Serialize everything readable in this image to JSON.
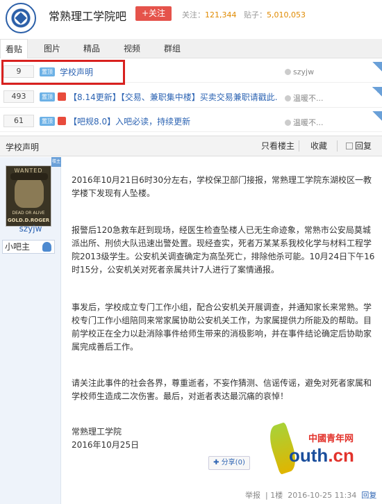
{
  "header": {
    "forum_name": "常熟理工学院吧",
    "follow_label": "+关注",
    "follow_count_label": "关注：",
    "follow_count": "121,344",
    "posts_label": "贴子：",
    "posts_count": "5,010,053"
  },
  "tabs": [
    {
      "label": "看贴",
      "active": true
    },
    {
      "label": "图片"
    },
    {
      "label": "精品"
    },
    {
      "label": "视频"
    },
    {
      "label": "群组"
    }
  ],
  "threads": [
    {
      "count": "9",
      "badge": "置顶",
      "title": "学校声明",
      "author": "szyjw"
    },
    {
      "count": "493",
      "badge": "置顶",
      "title": "【8.14更新】【交易、兼职集中楼】买卖交易兼职请戳此...",
      "author": "温暖不..."
    },
    {
      "count": "61",
      "badge": "置顶",
      "title": "【吧规8.0】入吧必读，持续更新",
      "author": "温暖不..."
    }
  ],
  "post_bar": {
    "title": "学校声明",
    "only_op": "只看楼主",
    "favorite": "收藏",
    "reply": "回复"
  },
  "author": {
    "name": "szyjw",
    "role": "小吧主",
    "avatar_top": "WANTED",
    "avatar_mid": "DEAD OR ALIVE",
    "avatar_bottom": "GOLD.D.ROGER",
    "op_tag": "楼主"
  },
  "post": {
    "paragraphs": [
      "2016年10月21日6时30分左右，学校保卫部门接报，常熟理工学院东湖校区一教学楼下发现有人坠楼。",
      "报警后120急救车赶到现场，经医生检查坠楼人已无生命迹象，常熟市公安局莫城派出所、刑侦大队迅速出警处置。现经查实，死者万某某系我校化学与材料工程学院2013级学生。公安机关调查确定为高坠死亡，排除他杀可能。10月24日下午16时15分，公安机关对死者亲属共计7人进行了案情通报。",
      "事发后，学校成立专门工作小组，配合公安机关开展调查，并通知家长来常熟。学校专门工作小组陪同来常家属协助公安机关工作，为家属提供力所能及的帮助。目前学校正在全力以赴消除事件给师生带来的消极影响，并在事件结论确定后协助家属完成善后工作。",
      "请关注此事件的社会各界，尊重逝者，不妄作猜测、信谣传谣，避免对死者家属和学校师生造成二次伤害。最后，对逝者表达最沉痛的哀悼！"
    ],
    "signature": "常熟理工学院",
    "date": "2016年10月25日",
    "share": "分享(0)"
  },
  "footer": {
    "report": "举报",
    "floor": "1楼",
    "timestamp": "2016-10-25 11:34",
    "reply": "回复"
  },
  "watermark": {
    "brand": "中國青年网",
    "domain_main": "outh",
    "domain_tld": ".cn"
  }
}
